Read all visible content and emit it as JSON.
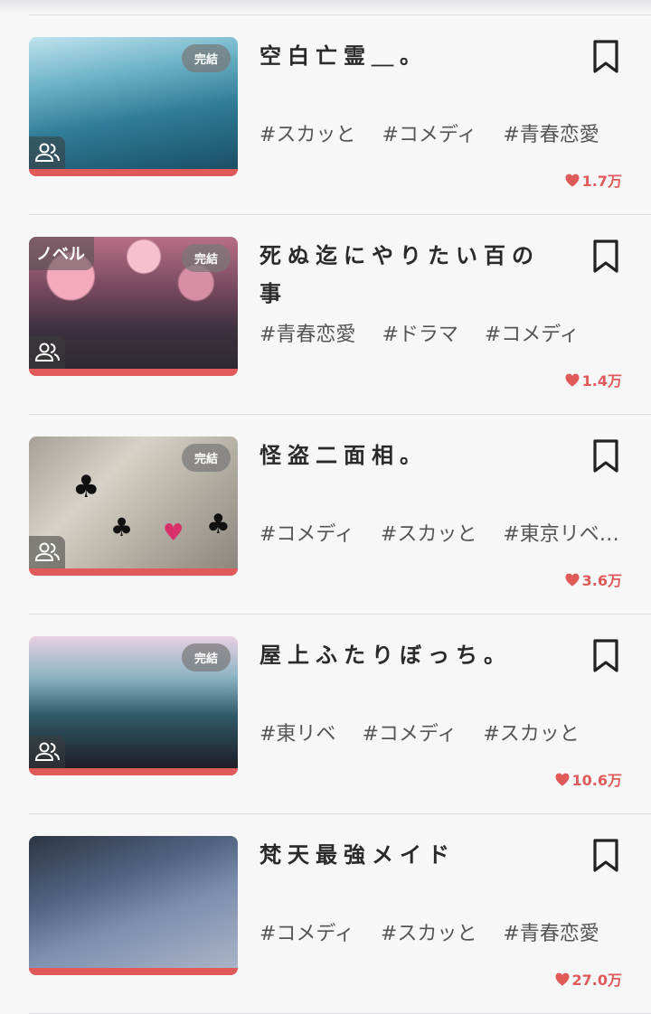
{
  "works": [
    {
      "title": "空白亡霊＿。",
      "badge_done": "完結",
      "badge_novel": "",
      "tags": [
        "#スカッと",
        "#コメディ",
        "#青春恋愛"
      ],
      "likes": "1.7万",
      "has_people_icon": true,
      "art": "water"
    },
    {
      "title": "死ぬ迄にやりたい百の事",
      "badge_done": "完結",
      "badge_novel": "ノベル",
      "tags": [
        "#青春恋愛",
        "#ドラマ",
        "#コメディ"
      ],
      "likes": "1.4万",
      "has_people_icon": true,
      "art": "flower"
    },
    {
      "title": "怪盗二面相。",
      "badge_done": "完結",
      "badge_novel": "",
      "tags": [
        "#コメディ",
        "#スカッと",
        "#東京リベ…"
      ],
      "likes": "3.6万",
      "has_people_icon": true,
      "art": "cards"
    },
    {
      "title": "屋上ふたりぼっち。",
      "badge_done": "完結",
      "badge_novel": "",
      "tags": [
        "#東リベ",
        "#コメディ",
        "#スカッと"
      ],
      "likes": "10.6万",
      "has_people_icon": true,
      "art": "city"
    },
    {
      "title": "梵天最強メイド",
      "badge_done": "",
      "badge_novel": "",
      "tags": [
        "#コメディ",
        "#スカッと",
        "#青春恋愛"
      ],
      "likes": "27.0万",
      "has_people_icon": false,
      "art": "room"
    }
  ],
  "colors": {
    "accent": "#e05a5a",
    "text": "#2a2a2a",
    "tag": "#555555"
  },
  "icons": {
    "bookmark": "bookmark-icon",
    "heart": "heart-icon",
    "people": "people-icon"
  }
}
